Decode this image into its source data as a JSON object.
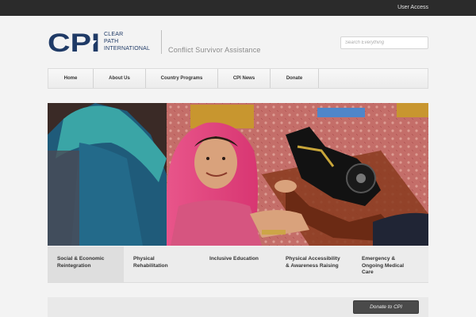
{
  "topbar": {
    "user_access": "User Access"
  },
  "header": {
    "logo_letters": "CPI",
    "logo_words": [
      "CLEAR",
      "PATH",
      "INTERNATIONAL"
    ],
    "tagline": "Conflict Survivor Assistance"
  },
  "search": {
    "placeholder": "Search Everything"
  },
  "nav": {
    "items": [
      {
        "label": "Home"
      },
      {
        "label": "About Us"
      },
      {
        "label": "Country Programs"
      },
      {
        "label": "CPI News"
      },
      {
        "label": "Donate"
      }
    ]
  },
  "programs": {
    "tabs": [
      {
        "line1": "Social & Economic",
        "line2": "Reintegration",
        "line3": "",
        "active": true
      },
      {
        "line1": "Physical",
        "line2": "Rehabilitation",
        "line3": "",
        "active": false
      },
      {
        "line1": "Inclusive Education",
        "line2": "",
        "line3": "",
        "active": false
      },
      {
        "line1": "Physical Accessibility",
        "line2": "& Awareness Raising",
        "line3": "",
        "active": false
      },
      {
        "line1": "Emergency &",
        "line2": "Ongoing Medical",
        "line3": "Care",
        "active": false
      }
    ]
  },
  "donate_button": {
    "label": "Donate to CPI"
  },
  "colors": {
    "brand": "#1f3a66",
    "topbar": "#2b2b2b",
    "pink_scarf": "#e0457b",
    "teal_scarf": "#3aa5a6"
  }
}
